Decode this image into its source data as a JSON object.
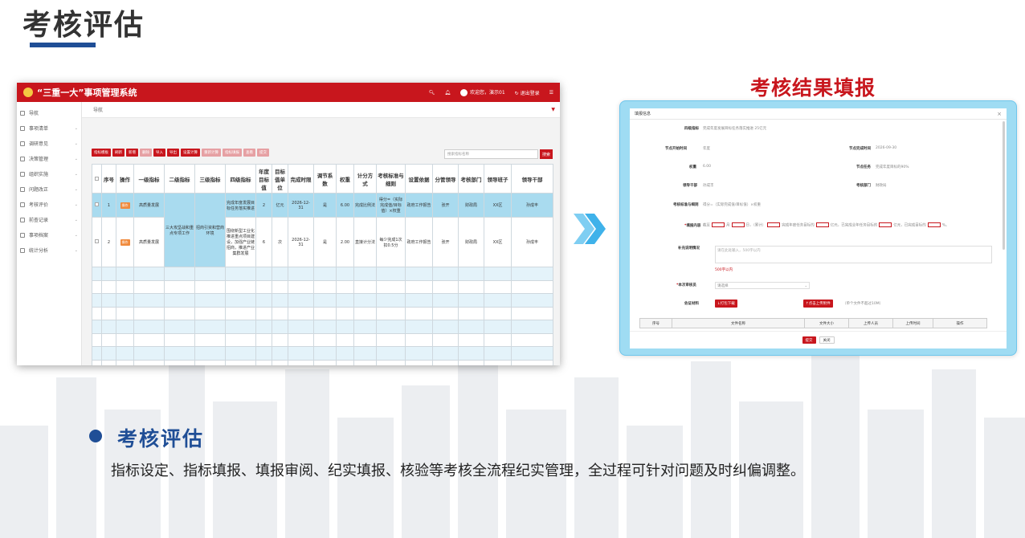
{
  "page": {
    "title": "考核评估",
    "right_title": "考核结果填报",
    "section_title": "考核评估",
    "section_desc": "指标设定、指标填报、填报审阅、纪实填报、核验等考核全流程纪实管理，全过程可针对问题及时纠偏调整。"
  },
  "app": {
    "system_name": "“三重一大”事项管理系统",
    "header": {
      "welcome": "欢迎您，演示01",
      "logout": "退出登录"
    },
    "breadcrumb": "导航",
    "sidebar": [
      {
        "label": "导航",
        "icon": "grid-icon"
      },
      {
        "label": "事项清单",
        "icon": "list-icon"
      },
      {
        "label": "调研意见",
        "icon": "chat-icon"
      },
      {
        "label": "决策管理",
        "icon": "decision-icon"
      },
      {
        "label": "组织实施",
        "icon": "bulb-icon"
      },
      {
        "label": "问题改正",
        "icon": "question-icon"
      },
      {
        "label": "考核评价",
        "icon": "chart-icon"
      },
      {
        "label": "前查记录",
        "icon": "record-icon"
      },
      {
        "label": "事项档案",
        "icon": "archive-icon"
      },
      {
        "label": "统计分析",
        "icon": "stats-icon"
      }
    ],
    "toolbar": [
      "指标模板",
      "刷新",
      "新增",
      "删除",
      "导入",
      "导出",
      "设置计算",
      "重新计算",
      "指标填报",
      "查看",
      "提交"
    ],
    "search_placeholder": "搜索指标名称",
    "search_button": "搜索",
    "columns": [
      "序号",
      "操作",
      "一级指标",
      "二级指标",
      "三级指标",
      "四级指标",
      "年度目标值",
      "目标值单位",
      "完成时限",
      "调节系数",
      "权重",
      "计分方式",
      "考核标准与细则",
      "设置依据",
      "分管领导",
      "考核部门",
      "领导班子",
      "领导干部"
    ],
    "rows": [
      {
        "no": "1",
        "op": "操作",
        "l1": "高质量发展",
        "l2": "",
        "l3": "",
        "l4": "完成年度发展目标任务落实推进",
        "target": "2",
        "unit": "亿元",
        "deadline": "2026-12-31",
        "coef": "是",
        "weight": "6.00",
        "scoring": "完成比例法",
        "standard": "得分=（实际完成值/目标值）×权重",
        "basis": "政府工作报告",
        "leader": "张开",
        "dept": "财政局",
        "team": "XX区",
        "cadre": "孙成丰"
      },
      {
        "no": "2",
        "op": "操作",
        "l1": "高质量发展",
        "l2": "",
        "l3": "",
        "l4": "围绕新型工业化推进重点项目建设，加强产业链招商，推进产业集群发展",
        "target": "6",
        "unit": "次",
        "deadline": "2026-12-31",
        "coef": "是",
        "weight": "2.00",
        "scoring": "直接计分法",
        "standard": "每少完成1次扣0.5分",
        "basis": "政府工作报告",
        "leader": "张开",
        "dept": "财政局",
        "team": "XX区",
        "cadre": "孙成丰"
      }
    ],
    "merged_l2": "三大攻坚战和重点专项工作",
    "merged_l3": "招商引资和营商环境"
  },
  "dialog": {
    "title": "填报信息",
    "fields": {
      "indicator_name_label": "四级指标",
      "indicator_name_value": "完成年度发展目标任务落实推进 25亿元",
      "start_time_label": "节点开始时间",
      "start_time_value": "年度",
      "end_time_label": "节点完成时间",
      "end_time_value": "2026-09-30",
      "weight_label": "权重",
      "weight_value": "6.00",
      "task_label": "节点任务",
      "task_value": "完成年度目标的90%",
      "leader_label": "领导干部",
      "leader_value": "孙成丰",
      "dept_label": "考核部门",
      "dept_value": "财政局",
      "standard_label": "考核标准与细则",
      "standard_value": "得分=（实际完成值/目标值）×权重",
      "fill_label": "填报内容",
      "fill_text_1": "截至",
      "fill_text_2": "月",
      "fill_text_3": "日，（累计）",
      "fill_text_4": "完成年度任务目标的",
      "fill_text_5": "亿元，已完成全年任务目标的",
      "fill_text_6": "亿元，已完成目标的",
      "fill_text_7": "%。",
      "note_label": "补充说明情况",
      "note_placeholder": "请在此处输入，500字以内",
      "note_limit": "500字以内",
      "review_label": "本次审核员",
      "review_value": "请选择",
      "attach_label": "佐证材料",
      "download_btn": "打包下载",
      "upload_btn": "点击上传附件",
      "upload_hint": "（单个文件不超过10M）"
    },
    "file_columns": [
      "序号",
      "文件名称",
      "文件大小",
      "上传人员",
      "上传时间",
      "操作"
    ],
    "submit": "提交",
    "close": "关闭"
  }
}
